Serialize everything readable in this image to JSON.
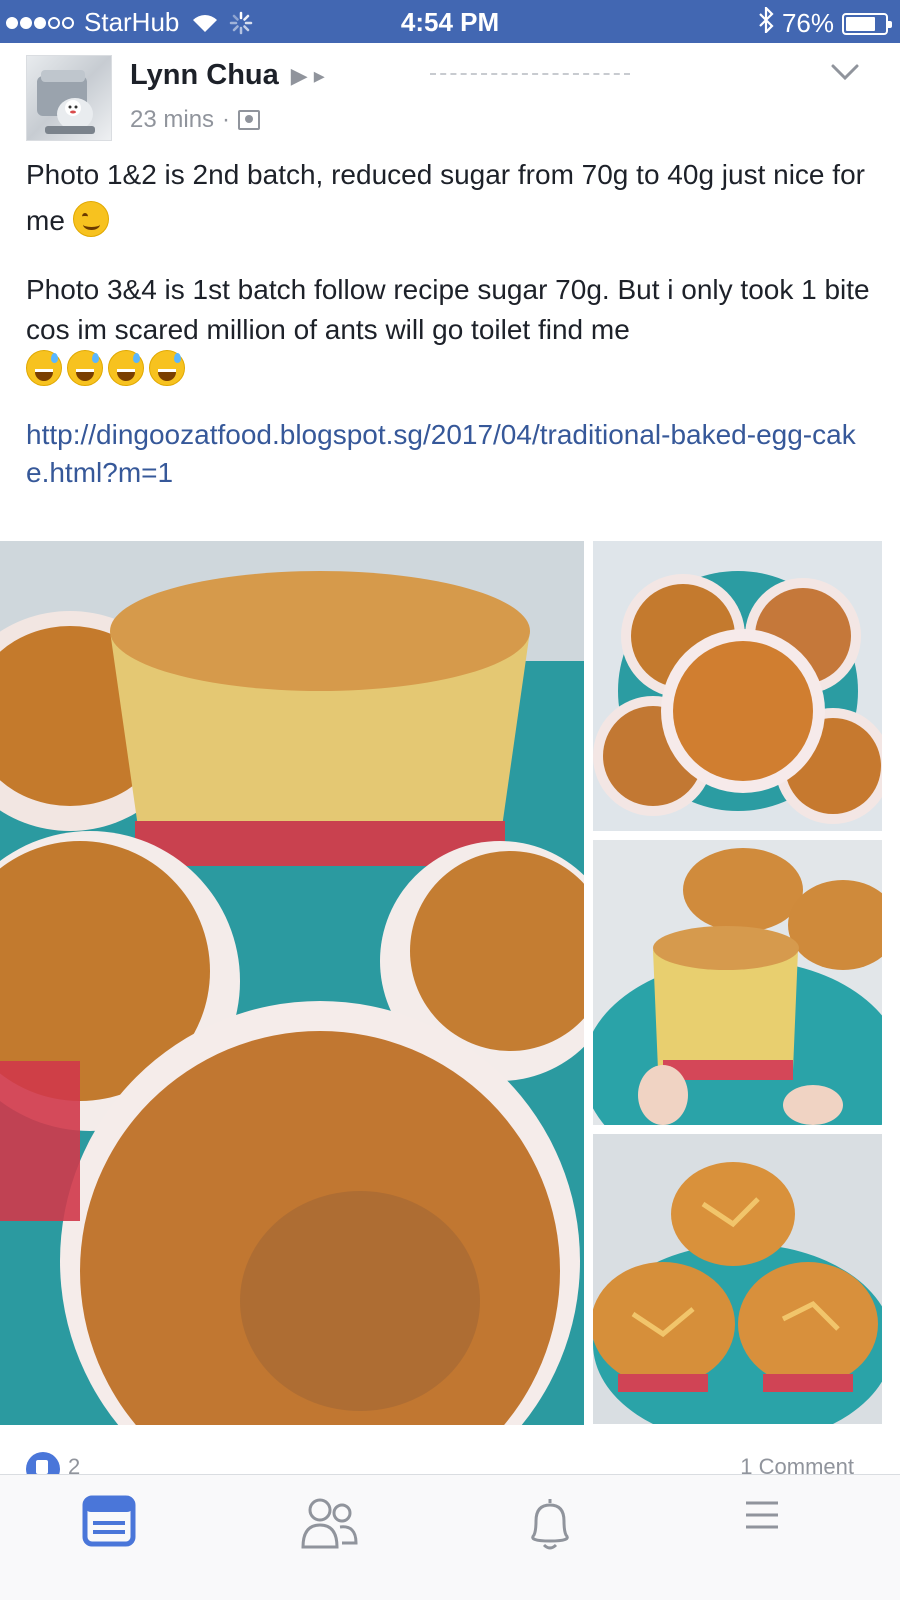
{
  "status_bar": {
    "carrier": "StarHub",
    "time": "4:54 PM",
    "battery": "76%",
    "battery_level": 0.76,
    "signal_bars_filled": 3,
    "signal_bars_total": 5
  },
  "post": {
    "author": "Lynn Chua",
    "timestamp": "23 mins",
    "meta_separator": "·",
    "paragraph_1": "Photo 1&2 is 2nd batch, reduced sugar from 70g to 40g just nice for me",
    "paragraph_2": "Photo 3&4 is 1st batch follow recipe sugar 70g. But i only took 1 bite cos im scared million of ants will go toilet find me",
    "link": "http://dingoozatfood.blogspot.sg/2017/04/traditional-baked-egg-cake.html?m=1",
    "reactions": {
      "like_count": "2",
      "comment_count": "1 Comment"
    }
  },
  "icons": {
    "emoji_1": "smiling-face-emoji",
    "emoji_2": "grinning-sweat-emoji",
    "audience": "friends-audience-icon",
    "options": "chevron-down-icon"
  },
  "colors": {
    "header_blue": "#4267b2",
    "link_blue": "#365899",
    "tab_active": "#4a76d9",
    "tab_inactive": "#90949c"
  }
}
